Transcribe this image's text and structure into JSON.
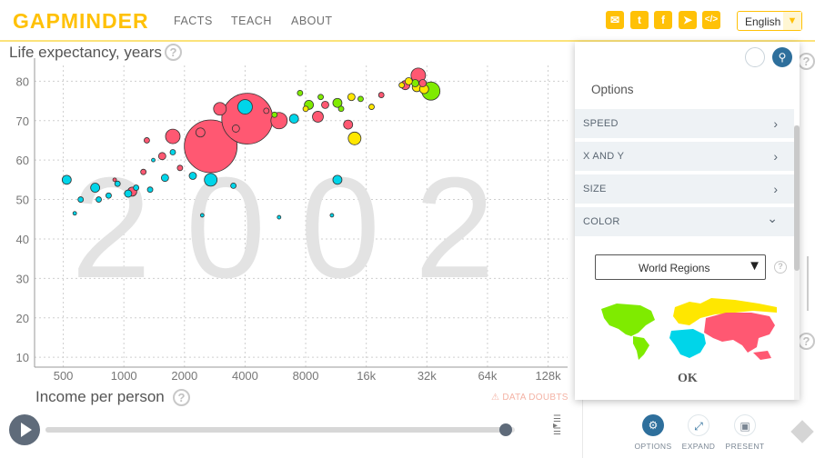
{
  "header": {
    "logo": "GAPMINDER",
    "nav": [
      "FACTS",
      "TEACH",
      "ABOUT"
    ],
    "social_icons": [
      "mail-icon",
      "twitter-icon",
      "facebook-icon",
      "telegram-icon",
      "embed-icon"
    ],
    "language": "English"
  },
  "chart": {
    "y_title": "Life expectancy, years",
    "x_title": "Income per person",
    "help_glyph": "?",
    "year": "2002",
    "data_doubts": "DATA DOUBTS"
  },
  "chart_data": {
    "type": "scatter",
    "title": "",
    "year_label": "2002",
    "xlabel": "Income per person",
    "ylabel": "Life expectancy, years",
    "x_scale": "log2",
    "x_ticks": [
      500,
      1000,
      2000,
      4000,
      8000,
      16000,
      32000,
      64000,
      128000
    ],
    "x_tick_labels": [
      "500",
      "1000",
      "2000",
      "4000",
      "8000",
      "16k",
      "32k",
      "64k",
      "128k"
    ],
    "y_ticks": [
      10,
      20,
      30,
      40,
      50,
      60,
      70,
      80
    ],
    "xlim": [
      360,
      160000
    ],
    "ylim": [
      7.5,
      84
    ],
    "grid": true,
    "color_key": {
      "africa": "#00d5e9",
      "asia": "#ff5872",
      "americas": "#7feb00",
      "europe": "#ffe700"
    },
    "points": [
      {
        "region": "asia",
        "x": 2700,
        "y": 63.5,
        "size": 29
      },
      {
        "region": "asia",
        "x": 4100,
        "y": 70.5,
        "size": 28
      },
      {
        "region": "asia",
        "x": 1750,
        "y": 66,
        "size": 8
      },
      {
        "region": "asia",
        "x": 5900,
        "y": 70,
        "size": 9
      },
      {
        "region": "asia",
        "x": 3000,
        "y": 73,
        "size": 7
      },
      {
        "region": "asia",
        "x": 1300,
        "y": 65,
        "size": 3
      },
      {
        "region": "asia",
        "x": 1550,
        "y": 61,
        "size": 4
      },
      {
        "region": "asia",
        "x": 2400,
        "y": 67,
        "size": 5
      },
      {
        "region": "asia",
        "x": 1100,
        "y": 52,
        "size": 5
      },
      {
        "region": "asia",
        "x": 29000,
        "y": 81.5,
        "size": 8
      },
      {
        "region": "asia",
        "x": 25000,
        "y": 79,
        "size": 5
      },
      {
        "region": "asia",
        "x": 13000,
        "y": 69,
        "size": 5
      },
      {
        "region": "asia",
        "x": 10000,
        "y": 74,
        "size": 4
      },
      {
        "region": "asia",
        "x": 9200,
        "y": 71,
        "size": 6
      },
      {
        "region": "asia",
        "x": 30500,
        "y": 79.5,
        "size": 4
      },
      {
        "region": "asia",
        "x": 1900,
        "y": 58,
        "size": 3
      },
      {
        "region": "asia",
        "x": 3600,
        "y": 68,
        "size": 4
      },
      {
        "region": "asia",
        "x": 5100,
        "y": 72.5,
        "size": 3
      },
      {
        "region": "asia",
        "x": 19000,
        "y": 76.5,
        "size": 3
      },
      {
        "region": "asia",
        "x": 1250,
        "y": 57,
        "size": 3
      },
      {
        "region": "asia",
        "x": 900,
        "y": 55,
        "size": 2
      },
      {
        "region": "africa",
        "x": 2700,
        "y": 55,
        "size": 7
      },
      {
        "region": "africa",
        "x": 2200,
        "y": 56,
        "size": 4
      },
      {
        "region": "africa",
        "x": 520,
        "y": 55,
        "size": 5
      },
      {
        "region": "africa",
        "x": 720,
        "y": 53,
        "size": 5
      },
      {
        "region": "africa",
        "x": 1050,
        "y": 51.5,
        "size": 4
      },
      {
        "region": "africa",
        "x": 750,
        "y": 50,
        "size": 3
      },
      {
        "region": "africa",
        "x": 1350,
        "y": 52.5,
        "size": 3
      },
      {
        "region": "africa",
        "x": 1600,
        "y": 55.5,
        "size": 4
      },
      {
        "region": "africa",
        "x": 11500,
        "y": 55,
        "size": 5
      },
      {
        "region": "africa",
        "x": 4000,
        "y": 73.5,
        "size": 8
      },
      {
        "region": "africa",
        "x": 7000,
        "y": 70.5,
        "size": 5
      },
      {
        "region": "africa",
        "x": 930,
        "y": 54,
        "size": 3
      },
      {
        "region": "africa",
        "x": 3500,
        "y": 53.5,
        "size": 3
      },
      {
        "region": "africa",
        "x": 610,
        "y": 50,
        "size": 3
      },
      {
        "region": "africa",
        "x": 840,
        "y": 51,
        "size": 3
      },
      {
        "region": "africa",
        "x": 1150,
        "y": 53,
        "size": 3
      },
      {
        "region": "africa",
        "x": 2450,
        "y": 46,
        "size": 2
      },
      {
        "region": "africa",
        "x": 5900,
        "y": 45.5,
        "size": 2
      },
      {
        "region": "africa",
        "x": 10800,
        "y": 46,
        "size": 2
      },
      {
        "region": "africa",
        "x": 570,
        "y": 46.5,
        "size": 2
      },
      {
        "region": "africa",
        "x": 1750,
        "y": 62,
        "size": 3
      },
      {
        "region": "africa",
        "x": 1400,
        "y": 60,
        "size": 2
      },
      {
        "region": "americas",
        "x": 33500,
        "y": 77.5,
        "size": 10
      },
      {
        "region": "americas",
        "x": 8300,
        "y": 74,
        "size": 5
      },
      {
        "region": "americas",
        "x": 11500,
        "y": 74.5,
        "size": 5
      },
      {
        "region": "americas",
        "x": 7500,
        "y": 77,
        "size": 3
      },
      {
        "region": "americas",
        "x": 9500,
        "y": 76,
        "size": 3
      },
      {
        "region": "americas",
        "x": 15000,
        "y": 75.5,
        "size": 3
      },
      {
        "region": "americas",
        "x": 28000,
        "y": 79.5,
        "size": 4
      },
      {
        "region": "americas",
        "x": 12000,
        "y": 73,
        "size": 3
      },
      {
        "region": "americas",
        "x": 5600,
        "y": 71.5,
        "size": 3
      },
      {
        "region": "europe",
        "x": 14000,
        "y": 65.5,
        "size": 7
      },
      {
        "region": "europe",
        "x": 28500,
        "y": 78.5,
        "size": 5
      },
      {
        "region": "europe",
        "x": 26000,
        "y": 80,
        "size": 4
      },
      {
        "region": "europe",
        "x": 31000,
        "y": 78,
        "size": 5
      },
      {
        "region": "europe",
        "x": 13500,
        "y": 76,
        "size": 4
      },
      {
        "region": "europe",
        "x": 8000,
        "y": 73,
        "size": 3
      },
      {
        "region": "europe",
        "x": 17000,
        "y": 73.5,
        "size": 3
      },
      {
        "region": "europe",
        "x": 24000,
        "y": 79,
        "size": 3
      }
    ]
  },
  "timeline": {
    "progress": 0.98
  },
  "panel": {
    "title": "Options",
    "rows": [
      {
        "label": "SPEED",
        "caret": "›"
      },
      {
        "label": "X AND Y",
        "caret": "›"
      },
      {
        "label": "SIZE",
        "caret": "›"
      },
      {
        "label": "COLOR",
        "caret": "⌄"
      }
    ],
    "color_select": "World Regions",
    "ok": "OK"
  },
  "bottom_buttons": [
    {
      "label": "OPTIONS",
      "icon": "gear-icon",
      "color": "#2e6f9c"
    },
    {
      "label": "EXPAND",
      "icon": "expand-icon",
      "color": "#ffffff"
    },
    {
      "label": "PRESENT",
      "icon": "present-icon",
      "color": "#ffffff"
    }
  ]
}
